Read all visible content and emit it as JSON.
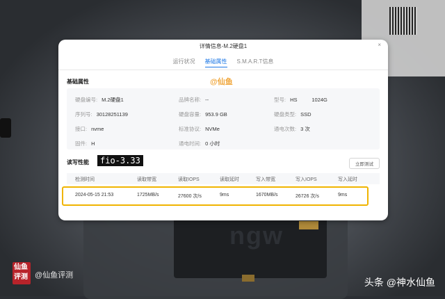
{
  "modal": {
    "title": "详情信息-M.2硬盘1",
    "close": "×",
    "tabs": [
      {
        "label": "运行状况"
      },
      {
        "label": "基础属性"
      },
      {
        "label": "S.M.A.R.T信息"
      }
    ]
  },
  "basic": {
    "section_title": "基础属性",
    "watermark": "@仙鱼",
    "fields": [
      {
        "key": "硬盘编号:",
        "value": "M.2硬盘1"
      },
      {
        "key": "品牌名称:",
        "value": "--"
      },
      {
        "key": "型号:",
        "value": "HS          1024G"
      },
      {
        "key": "序列号:",
        "value": "30128251139"
      },
      {
        "key": "硬盘容量:",
        "value": "953.9 GB"
      },
      {
        "key": "硬盘类型:",
        "value": "SSD"
      },
      {
        "key": "接口:",
        "value": "nvme"
      },
      {
        "key": "标准协议:",
        "value": "NVMe"
      },
      {
        "key": "通电次数:",
        "value": "3 次"
      },
      {
        "key": "固件:",
        "value": "H"
      },
      {
        "key": "通电时间:",
        "value": "0 小时"
      }
    ]
  },
  "perf": {
    "section_title": "读写性能",
    "overlay_label": "fio-3.33",
    "button": "立即测试",
    "headers": [
      "检测时间",
      "读取带宽",
      "读取IOPS",
      "读取延时",
      "写入带宽",
      "写入IOPS",
      "写入延时"
    ],
    "rows": [
      [
        "2024-05-15 21:53",
        "1725MB/s",
        "27600 次/s",
        "9ms",
        "1670MB/s",
        "26726 次/s",
        "9ms"
      ]
    ]
  },
  "footer": {
    "brand_logo_text": "仙鱼评测",
    "brand_watermark": "@仙鱼评测",
    "source": "头条 @神水仙鱼"
  },
  "colors": {
    "accent": "#1e78e6",
    "highlight": "#f0b400",
    "watermark": "#f0a63a",
    "logo": "#b8232a"
  }
}
